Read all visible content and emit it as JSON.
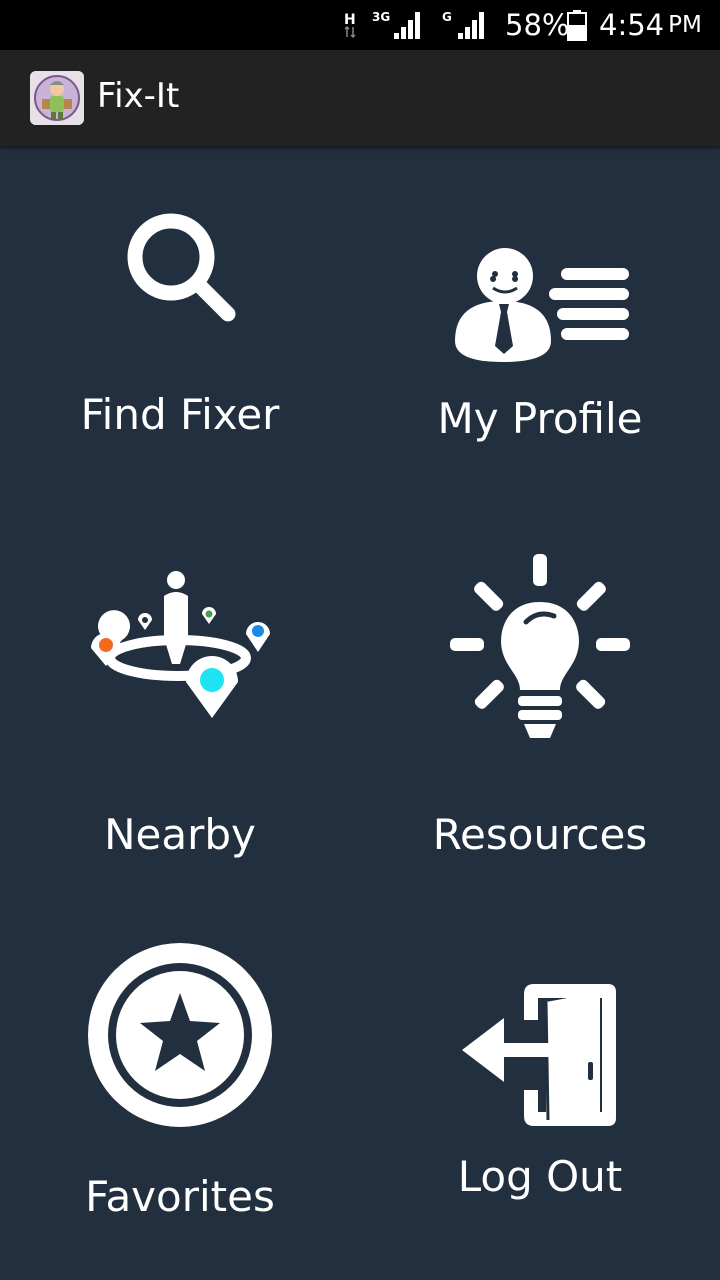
{
  "status_bar": {
    "network_h": "H",
    "network_3g": "3G",
    "network_g": "G",
    "battery": "58%",
    "time": "4:54",
    "ampm": "PM"
  },
  "app_bar": {
    "title": "Fix-It"
  },
  "menu": {
    "find_fixer": "Find Fixer",
    "my_profile": "My Profile",
    "nearby": "Nearby",
    "resources": "Resources",
    "favorites": "Favorites",
    "log_out": "Log Out"
  },
  "colors": {
    "background": "#222f3e",
    "app_bar": "#222222",
    "icon": "#ffffff",
    "pin_orange": "#f26b1d",
    "pin_cyan": "#1ee3f0",
    "pin_blue": "#1e88e5",
    "pin_green": "#43a047"
  }
}
